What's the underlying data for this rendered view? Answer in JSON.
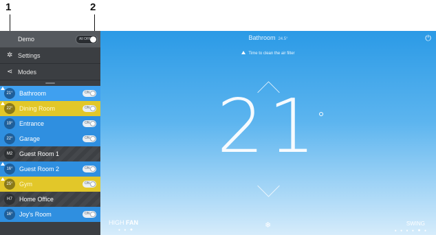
{
  "callouts": [
    "1",
    "2"
  ],
  "sidebar": {
    "header": {
      "label": "Demo",
      "toggle": "All OFF"
    },
    "menu": [
      {
        "icon": "settings-icon",
        "label": "Settings"
      },
      {
        "icon": "modes-icon",
        "label": "Modes"
      }
    ],
    "rooms": [
      {
        "temp": "21°",
        "name": "Bathroom",
        "toggle": "ON",
        "style": "active",
        "warning": true
      },
      {
        "temp": "22°",
        "name": "Dining Room",
        "toggle": "ON",
        "style": "yellow",
        "warning": true
      },
      {
        "temp": "19°",
        "name": "Entrance",
        "toggle": "ON",
        "style": "blue",
        "warning": false
      },
      {
        "temp": "22°",
        "name": "Garage",
        "toggle": "ON",
        "style": "blue",
        "warning": false
      },
      {
        "temp": "M2",
        "name": "Guest Room 1",
        "toggle": "",
        "style": "off",
        "warning": false
      },
      {
        "temp": "16°",
        "name": "Guest Room 2",
        "toggle": "ON",
        "style": "blue",
        "warning": true
      },
      {
        "temp": "25°",
        "name": "Gym",
        "toggle": "ON",
        "style": "yellow",
        "warning": true
      },
      {
        "temp": "H7",
        "name": "Home Office",
        "toggle": "",
        "style": "off",
        "warning": false
      },
      {
        "temp": "16°",
        "name": "Joy's Room",
        "toggle": "ON",
        "style": "blue",
        "warning": false
      }
    ]
  },
  "main": {
    "title": "Bathroom",
    "title_sub": "24.5°",
    "notice": "Time to clean the air filter",
    "setpoint": "21",
    "fan_light": "HIGH",
    "fan_bold": "FAN",
    "swing": "SWING"
  },
  "colors": {
    "accent": "#2f8fe0",
    "yellow": "#e2c729",
    "sidebar": "#3b3e42"
  }
}
